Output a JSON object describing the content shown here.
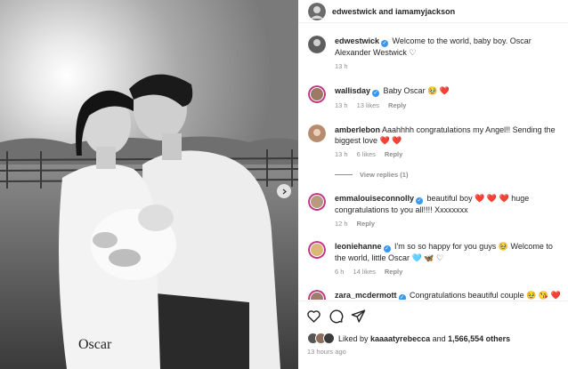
{
  "post": {
    "authors": "edwestwick and iamamyjackson",
    "photo_text": "Oscar"
  },
  "comments": [
    {
      "username": "edwestwick",
      "verified": true,
      "text": "Welcome to the world, baby boy. Oscar Alexander Westwick ♡",
      "time": "13 h",
      "likes": "",
      "reply": ""
    },
    {
      "username": "wallisday",
      "verified": true,
      "text": "Baby Oscar 🥹 ❤️",
      "time": "13 h",
      "likes": "13 likes",
      "reply": "Reply"
    },
    {
      "username": "amberlebon",
      "verified": false,
      "text": "Aaahhhh congratulations my Angel!! Sending the biggest love ❤️ ❤️",
      "time": "13 h",
      "likes": "6 likes",
      "reply": "Reply"
    },
    {
      "username": "emmalouiseconnolly",
      "verified": true,
      "text": "beautiful boy ❤️ ❤️ ❤️ huge congratulations to you all!!!! Xxxxxxxx",
      "time": "12 h",
      "likes": "",
      "reply": "Reply"
    },
    {
      "username": "leoniehanne",
      "verified": true,
      "text": "I'm so so happy for you guys 🥹 Welcome to the world, little Oscar 🩵 🦋 ♡",
      "time": "6 h",
      "likes": "14 likes",
      "reply": "Reply"
    },
    {
      "username": "zara_mcdermott",
      "verified": true,
      "text": "Congratulations beautiful couple 🥹 😘 ❤️",
      "time": "",
      "likes": "",
      "reply": ""
    }
  ],
  "view_replies": "View replies (1)",
  "likes": {
    "prefix": "Liked by ",
    "user": "kaaaatyrebecca",
    "middle": " and ",
    "count": "1,566,554 others"
  },
  "posted_ago": "13 hours ago",
  "icons": [
    "heart-icon",
    "comment-icon",
    "share-icon",
    "verified-icon",
    "chevron-right-icon"
  ],
  "colors": {
    "verified": "#3897f0",
    "secondary_text": "#8e8e8e",
    "text": "#262626"
  }
}
